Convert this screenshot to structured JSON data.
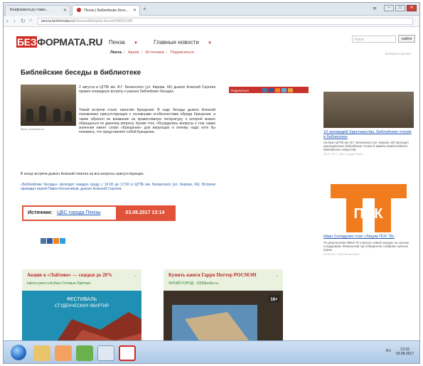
{
  "browser": {
    "tabs": [
      {
        "label": "Безформата.ру главн...",
        "active": false
      },
      {
        "label": "Пенза | Библейские бесе...",
        "active": true
      }
    ],
    "address": {
      "scheme_host": "penza.bezformata.ru",
      "path": "/listnews/biblejskie-besedi/58051258/"
    }
  },
  "site": {
    "logo_mark": "БЕЗ",
    "logo_rest": "ФОРМАТА.RU",
    "region_label": "Пенза",
    "nav_main_news": "Главные новости",
    "subnav": [
      {
        "label": "Лента",
        "current": true
      },
      {
        "label": "Архив",
        "current": false
      },
      {
        "label": "Источники",
        "current": false
      },
      {
        "label": "Подписаться",
        "current": false
      }
    ],
    "search_placeholder": "Найти",
    "search_button": "найти",
    "region_hint": "Выберите регион"
  },
  "article": {
    "title": "Библейские беседы в библиотеке",
    "photo_caption": "Фото: penzacbs.ru",
    "lead": "2 августа в ЦГПБ им. В.Г. Белинского (ул. Кирова, 66) дьякон Алексий Сергеев провел очередную встречу о ранних библейских беседах.",
    "paragraphs": [
      "Темой встречи стало таинство Крещения. В ходе беседы дьякон Алексий познакомил присутствующих с основными особенностями обряда Крещения, а также обратил их внимание на православную литературу, к которой можно обращаться по данному вопросу. Кроме того, обсуждались вопросы о том, какие значения имеет слово «Крещение» для верующих и почему надо хотя бы понимать, что представляет собой Крещение.",
      "В конце встречи дьякон Алексий ответил на все вопросы присутствующих.",
      "«Библейские беседы» проходят каждую среду с 16:00 до 17:00 в ЦГПБ им. Белинского (ул. Кирова, 66). Встречи проводит иерей Павел Колончиков, дьякон Алексий Сергеев."
    ],
    "share_label": "Поделиться",
    "source_label": "Источник:",
    "source_link": "ЦБС города Пензы",
    "source_date": "03.08.2017 13:14"
  },
  "sidebar": {
    "items": [
      {
        "link": "10 заповедей Христианства. Библейские чтения в библиотеке",
        "text": "На базе ЦГПБ им. В.Г. Белинского (ул. Кирова, 66) проходят еженедельные библейские чтения в рамках православного библейского общества.",
        "meta": "30.07.2017 | ЦБС города Пензы"
      },
      {
        "link": "Иван Солодухин стал «Лицом ПСК 78»",
        "text": "По результатам ЛВКИ 78 стартует новый конкурс на лучших сотрудников. Финальный тур победители собирают ценные призы.",
        "meta": "02.08.2017 | ИА Пенза-Пресс"
      }
    ],
    "logo_text": "ПСК"
  },
  "ads": [
    {
      "heading": "Акции в «Лайтово» — скидки до 20%",
      "source": "laitovo-penz.ru/Urban-Готовые-Лайтово",
      "image_text_1": "ФЕСТИВАЛЬ",
      "image_text_2": "СТУДЕНЧЕСКИХ КВАРТИР"
    },
    {
      "heading": "Купить книги Гарри Поттер РОСМЭН",
      "source": "ЧИТАЙ-ГОРОД · 1000books.ru",
      "age_badge": "18+"
    }
  ],
  "taskbar": {
    "time": "13:15",
    "date": "03.08.2017",
    "lang": "RU"
  },
  "colors": {
    "brand": "#d02a22",
    "link": "#1f55b3",
    "source_accent": "#e0523a",
    "ad_background": "#eaf2df"
  }
}
